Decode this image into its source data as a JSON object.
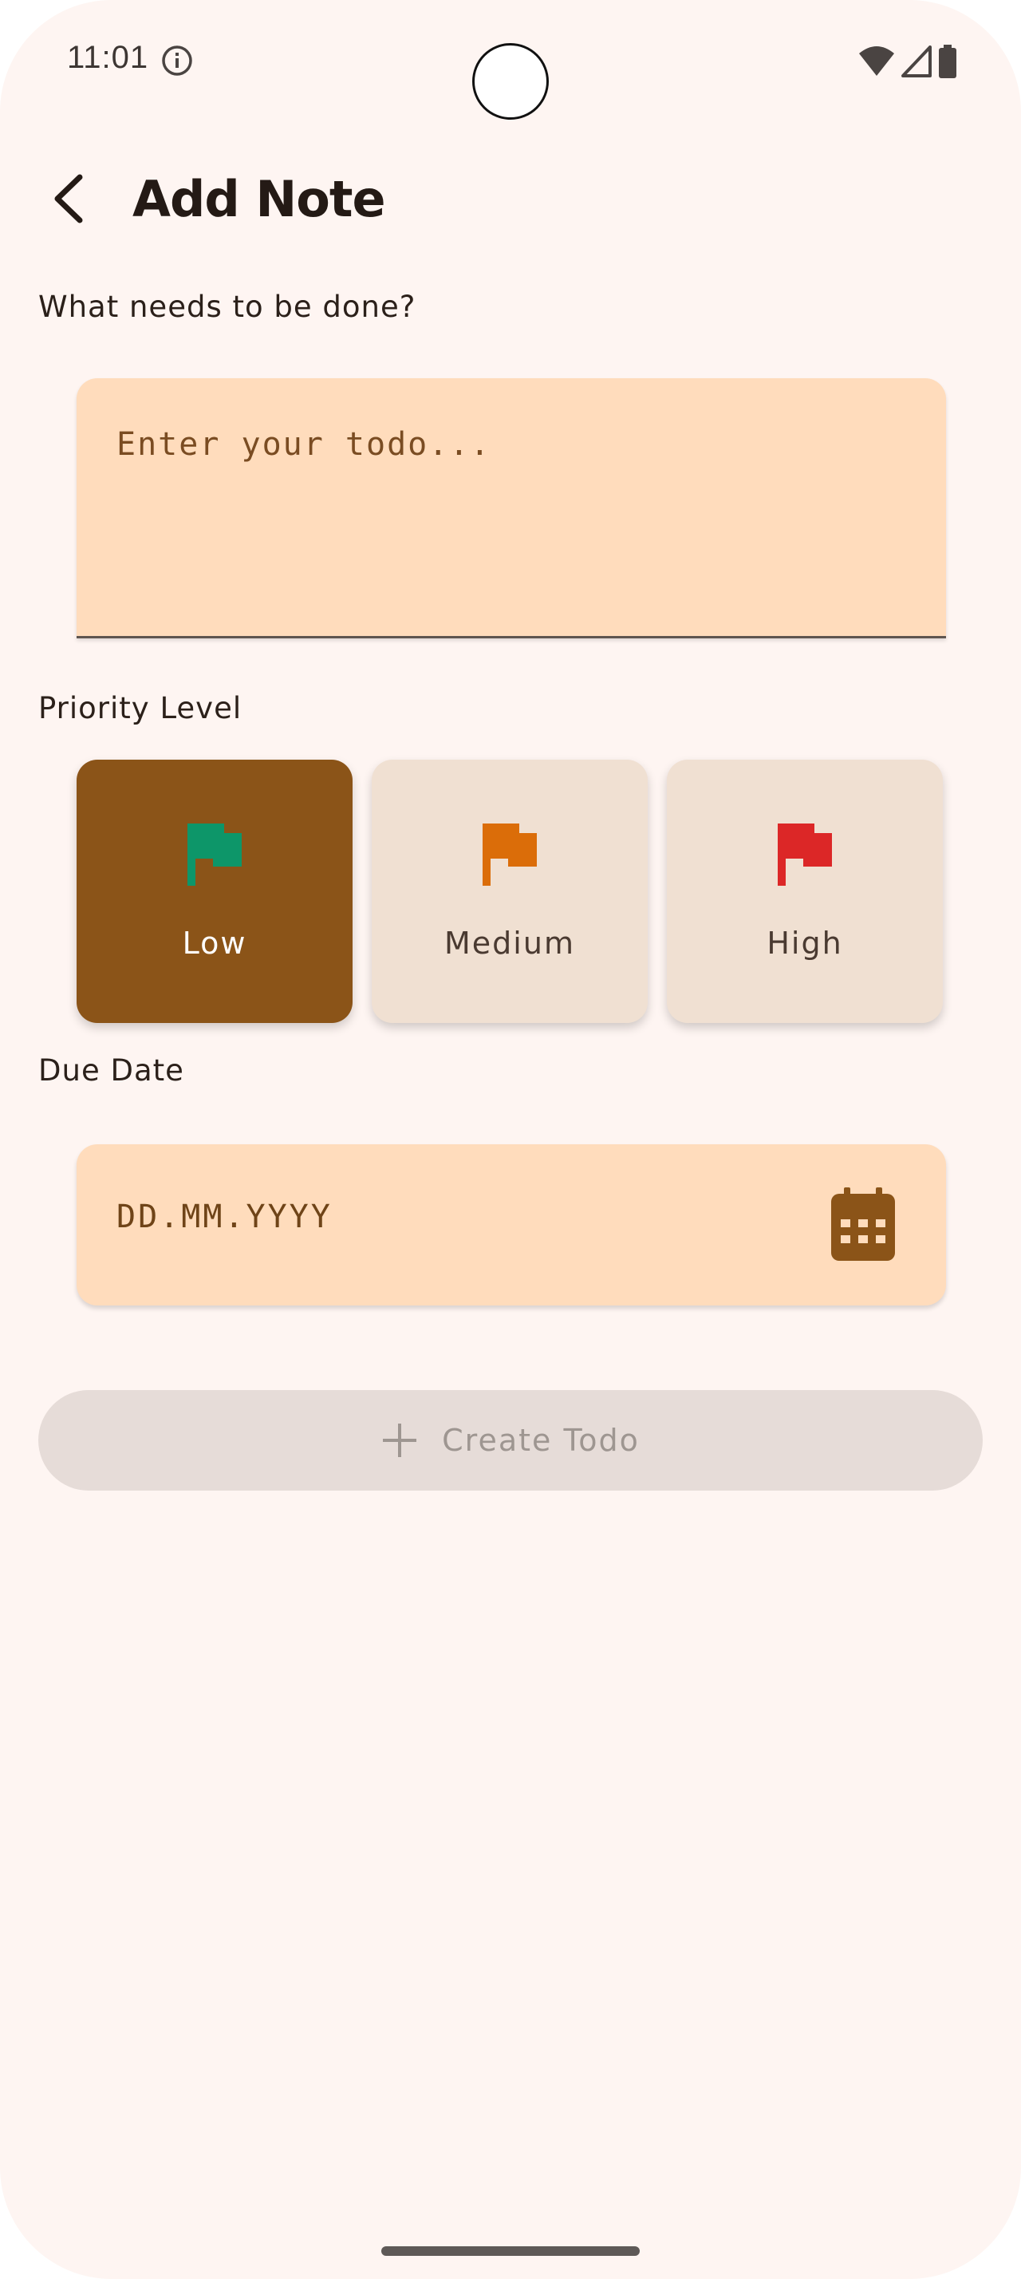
{
  "status_bar": {
    "time": "11:01",
    "info_icon": "info-circle-icon",
    "wifi_icon": "wifi-icon",
    "signal_icon": "cell-signal-icon",
    "battery_icon": "battery-icon"
  },
  "header": {
    "back_icon": "chevron-left-icon",
    "title": "Add Note"
  },
  "todo_section": {
    "label": "What needs to be done?",
    "placeholder": "Enter your todo...",
    "value": ""
  },
  "priority_section": {
    "label": "Priority Level",
    "options": [
      {
        "label": "Low",
        "icon": "flag-icon",
        "flag_color": "#0d9669",
        "selected": true
      },
      {
        "label": "Medium",
        "icon": "flag-icon",
        "flag_color": "#db6d09",
        "selected": false
      },
      {
        "label": "High",
        "icon": "flag-icon",
        "flag_color": "#dc2727",
        "selected": false
      }
    ]
  },
  "due_date_section": {
    "label": "Due Date",
    "placeholder": "DD.MM.YYYY",
    "value": "",
    "icon": "calendar-icon"
  },
  "create_button": {
    "label": "Create Todo",
    "icon": "plus-icon",
    "enabled": false
  },
  "colors": {
    "background": "#fef5f2",
    "input_fill": "#ffdcbc",
    "accent_brown": "#8b5418",
    "card_fill": "#f0e0d2",
    "disabled_button": "#e6dcd8"
  }
}
